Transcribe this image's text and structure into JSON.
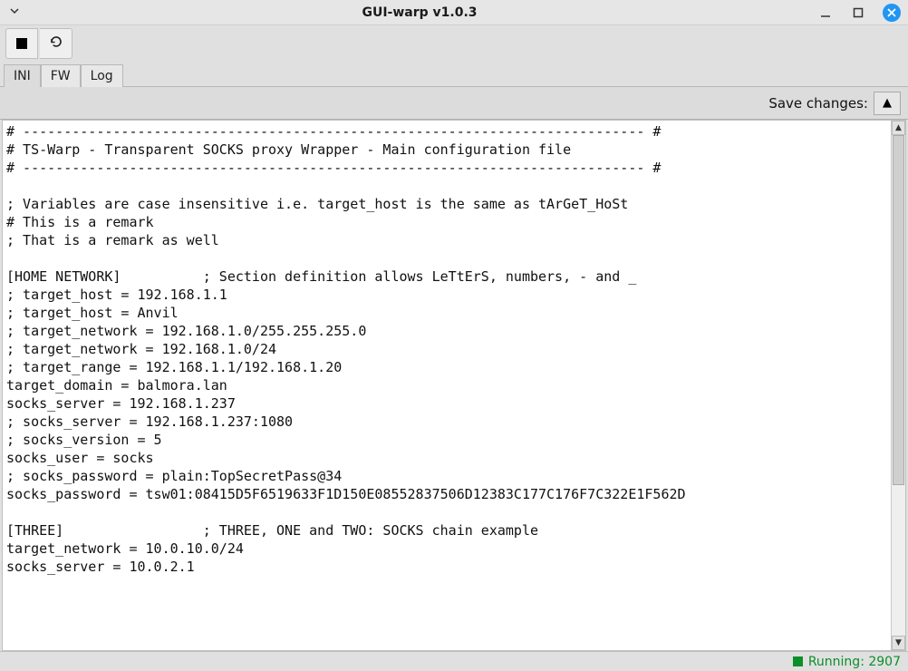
{
  "window": {
    "title": "GUI-warp v1.0.3"
  },
  "toolbar": {
    "stop_tooltip": "Stop",
    "reload_tooltip": "Reload"
  },
  "tabs": [
    {
      "label": "INI",
      "active": true
    },
    {
      "label": "FW",
      "active": false
    },
    {
      "label": "Log",
      "active": false
    }
  ],
  "subbar": {
    "save_label": "Save changes:",
    "save_glyph": "▲"
  },
  "editor": {
    "text": "# ---------------------------------------------------------------------------- #\n# TS-Warp - Transparent SOCKS proxy Wrapper - Main configuration file\n# ---------------------------------------------------------------------------- #\n\n; Variables are case insensitive i.e. target_host is the same as tArGeT_HoSt\n# This is a remark\n; That is a remark as well\n\n[HOME NETWORK]          ; Section definition allows LeTtErS, numbers, - and _\n; target_host = 192.168.1.1\n; target_host = Anvil\n; target_network = 192.168.1.0/255.255.255.0\n; target_network = 192.168.1.0/24\n; target_range = 192.168.1.1/192.168.1.20\ntarget_domain = balmora.lan\nsocks_server = 192.168.1.237\n; socks_server = 192.168.1.237:1080\n; socks_version = 5\nsocks_user = socks\n; socks_password = plain:TopSecretPass@34\nsocks_password = tsw01:08415D5F6519633F1D150E08552837506D12383C177C176F7C322E1F562D\n\n[THREE]                 ; THREE, ONE and TWO: SOCKS chain example\ntarget_network = 10.0.10.0/24\nsocks_server = 10.0.2.1"
  },
  "status": {
    "text": "Running: 2907"
  }
}
